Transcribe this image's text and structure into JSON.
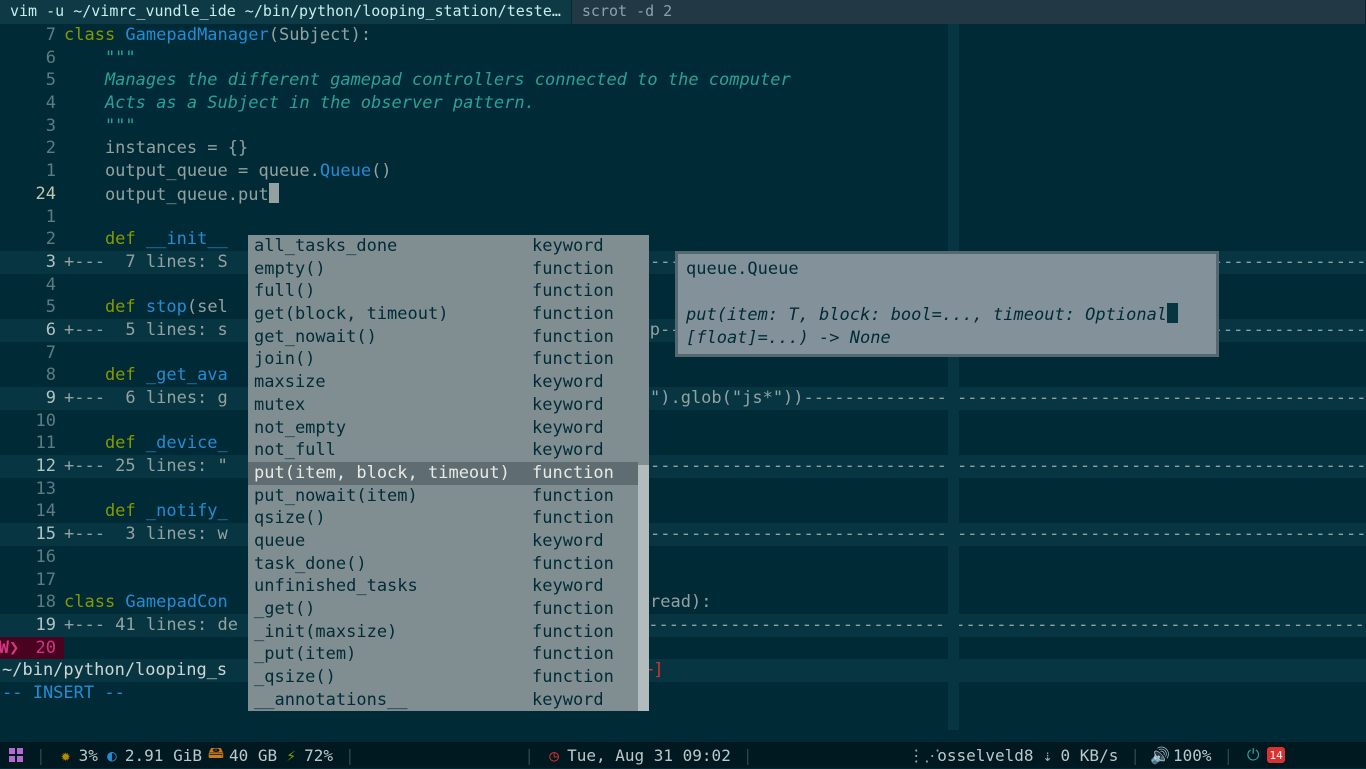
{
  "tabs": {
    "active": "vim -u ~/vimrc_vundle_ide ~/bin/python/looping_station/teste…",
    "inactive": "scrot -d 2"
  },
  "gutter": [
    "7",
    "6",
    "5",
    "4",
    "3",
    "2",
    "1",
    "24",
    "1",
    "2",
    "3",
    "4",
    "5",
    "6",
    "7",
    "8",
    "9",
    "10",
    "11",
    "12",
    "13",
    "14",
    "15",
    "16",
    "17",
    "18",
    "19",
    "20"
  ],
  "current_line_index": 7,
  "warn_line_index": 27,
  "warn_mark": "W❯",
  "code": {
    "l0": {
      "pre": "",
      "kw": "class ",
      "cls": "GamepadManager",
      "rest": "(Subject):"
    },
    "l1": "    \"\"\"",
    "l2": "    Manages the different gamepad controllers connected to the computer",
    "l3": "    Acts as a Subject in the observer pattern.",
    "l4": "    \"\"\"",
    "l5": "    instances = {}",
    "l6": {
      "a": "    output_queue = queue.",
      "b": "Queue",
      "c": "()"
    },
    "l7": "    output_queue.put",
    "l8": "",
    "l9": {
      "kw": "    def ",
      "fn": "__init__"
    },
    "f10": "+---  7 lines: S",
    "l11": "",
    "l12": {
      "kw": "    def ",
      "fn": "stop",
      "args": "(sel"
    },
    "f13": "+---  5 lines: s",
    "l14": "",
    "l15": {
      "kw": "    def ",
      "fn": "_get_ava"
    },
    "f16": "+---  6 lines: g",
    "f16b": "t\").glob(\"js*\"))",
    "l17": "",
    "l18": {
      "kw": "    def ",
      "fn": "_device_"
    },
    "f19": "+--- 25 lines: \"",
    "l20": "",
    "l21": {
      "kw": "    def ",
      "fn": "_notify_"
    },
    "f22": "+---  3 lines: w",
    "l23": "",
    "l24": "",
    "l25": {
      "kw": "class ",
      "cls": "GamepadCon",
      "mid": "",
      "tail": "hread):"
    },
    "f26": "+--- 41 lines: de",
    "l27": ""
  },
  "popup": {
    "selected_index": 10,
    "items": [
      {
        "name": "all_tasks_done",
        "kind": "keyword"
      },
      {
        "name": "empty()",
        "kind": "function"
      },
      {
        "name": "full()",
        "kind": "function"
      },
      {
        "name": "get(block, timeout)",
        "kind": "function"
      },
      {
        "name": "get_nowait()",
        "kind": "function"
      },
      {
        "name": "join()",
        "kind": "function"
      },
      {
        "name": "maxsize",
        "kind": "keyword"
      },
      {
        "name": "mutex",
        "kind": "keyword"
      },
      {
        "name": "not_empty",
        "kind": "keyword"
      },
      {
        "name": "not_full",
        "kind": "keyword"
      },
      {
        "name": "put(item, block, timeout)",
        "kind": "function"
      },
      {
        "name": "put_nowait(item)",
        "kind": "function"
      },
      {
        "name": "qsize()",
        "kind": "function"
      },
      {
        "name": "queue",
        "kind": "keyword"
      },
      {
        "name": "task_done()",
        "kind": "function"
      },
      {
        "name": "unfinished_tasks",
        "kind": "keyword"
      },
      {
        "name": "_get()",
        "kind": "function"
      },
      {
        "name": "_init(maxsize)",
        "kind": "function"
      },
      {
        "name": "_put(item)",
        "kind": "function"
      },
      {
        "name": "_qsize()",
        "kind": "function"
      },
      {
        "name": "__annotations__",
        "kind": "keyword"
      }
    ]
  },
  "doc": {
    "header": "queue.Queue",
    "sig": "put(item: T, block: bool=..., timeout: Optional",
    "sig2": "[float]=...) -> None"
  },
  "status": {
    "path": "~/bin/python/looping_s",
    "path_tail": "+]",
    "mode": "-- INSERT --"
  },
  "taskbar": {
    "cpu": "3%",
    "mem": "2.91 GiB",
    "disk": "40 GB",
    "battery": "72%",
    "clock": "Tue, Aug 31 09:02",
    "wifi": "osselveld8",
    "net": "0 KB/s",
    "vol": "100%",
    "bug": "14"
  }
}
